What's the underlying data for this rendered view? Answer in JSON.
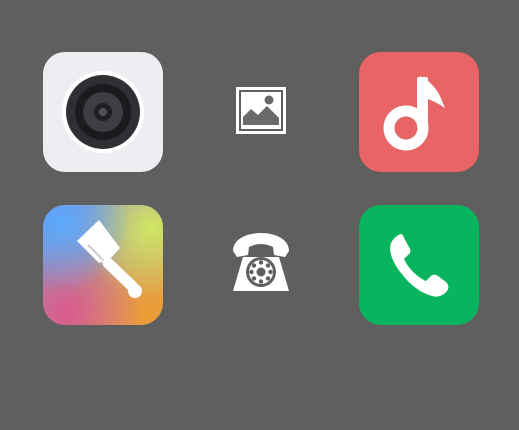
{
  "screen": {
    "background": "#5f5f5f"
  },
  "apps": [
    {
      "id": "camera",
      "icon": "camera-lens-icon",
      "tile_color": "#eceef2"
    },
    {
      "id": "gallery",
      "icon": "image-icon",
      "tile_color": "none"
    },
    {
      "id": "music",
      "icon": "music-note-icon",
      "tile_color": "#e96565"
    },
    {
      "id": "themes",
      "icon": "paint-brush-icon",
      "tile_color": "gradient"
    },
    {
      "id": "retro-phone",
      "icon": "rotary-phone-icon",
      "tile_color": "none"
    },
    {
      "id": "phone",
      "icon": "phone-handset-icon",
      "tile_color": "#08b45e"
    }
  ]
}
